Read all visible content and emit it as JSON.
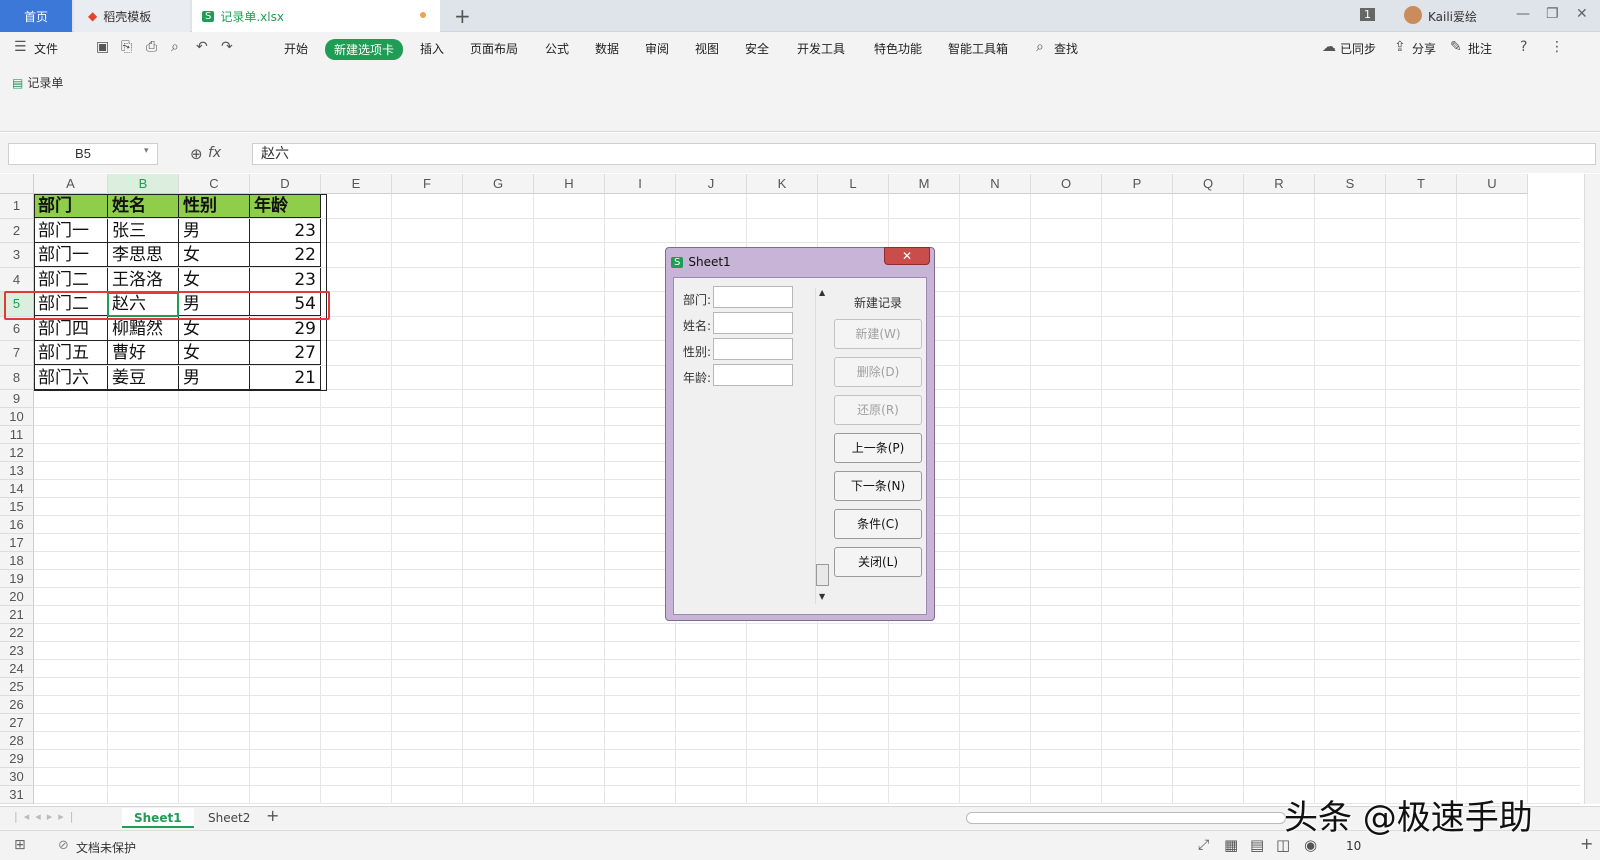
{
  "tabs": {
    "home": "首页",
    "templates": "稻壳模板",
    "file": "记录单.xlsx"
  },
  "user": {
    "name": "Kaili爱绘",
    "window_count": "1"
  },
  "menu": {
    "file": "文件",
    "start": "开始",
    "new_tab": "新建选项卡",
    "insert": "插入",
    "layout": "页面布局",
    "formula": "公式",
    "data": "数据",
    "review": "审阅",
    "view": "视图",
    "security": "安全",
    "dev": "开发工具",
    "special": "特色功能",
    "smart": "智能工具箱",
    "find": "查找",
    "sync": "已同步",
    "share": "分享",
    "comment": "批注"
  },
  "ribbon": {
    "record_form": "记录单"
  },
  "formula_bar": {
    "cell_ref": "B5",
    "fx": "fx",
    "value": "赵六"
  },
  "columns": [
    "A",
    "B",
    "C",
    "D",
    "E",
    "F",
    "G",
    "H",
    "I",
    "J",
    "K",
    "L",
    "M",
    "N",
    "O",
    "P",
    "Q",
    "R",
    "S",
    "T",
    "U"
  ],
  "rows": [
    "1",
    "2",
    "3",
    "4",
    "5",
    "6",
    "7",
    "8",
    "9",
    "10",
    "11",
    "12",
    "13",
    "14",
    "15",
    "16",
    "17",
    "18",
    "19",
    "20",
    "21",
    "22",
    "23",
    "24",
    "25",
    "26",
    "27",
    "28",
    "29",
    "30",
    "31"
  ],
  "table": {
    "headers": [
      "部门",
      "姓名",
      "性别",
      "年龄"
    ],
    "rows": [
      [
        "部门一",
        "张三",
        "男",
        "23"
      ],
      [
        "部门一",
        "李思思",
        "女",
        "22"
      ],
      [
        "部门二",
        "王洛洛",
        "女",
        "23"
      ],
      [
        "部门二",
        "赵六",
        "男",
        "54"
      ],
      [
        "部门四",
        "柳黯然",
        "女",
        "29"
      ],
      [
        "部门五",
        "曹好",
        "女",
        "27"
      ],
      [
        "部门六",
        "姜豆",
        "男",
        "21"
      ]
    ]
  },
  "dialog": {
    "title": "Sheet1",
    "close": "✕",
    "fields": [
      "部门:",
      "姓名:",
      "性别:",
      "年龄:"
    ],
    "record_label": "新建记录",
    "buttons": {
      "new": "新建(W)",
      "delete": "删除(D)",
      "restore": "还原(R)",
      "prev": "上一条(P)",
      "next": "下一条(N)",
      "criteria": "条件(C)",
      "close": "关闭(L)"
    }
  },
  "sheets": [
    "Sheet1",
    "Sheet2"
  ],
  "status": {
    "protect": "文档未保护",
    "zoom": "10"
  },
  "watermark": "头条 @极速手助",
  "colors": {
    "accent": "#1f9d55",
    "header_fill": "#8fce4b",
    "highlight": "#e03a3a",
    "home_tab": "#3b78d8"
  }
}
